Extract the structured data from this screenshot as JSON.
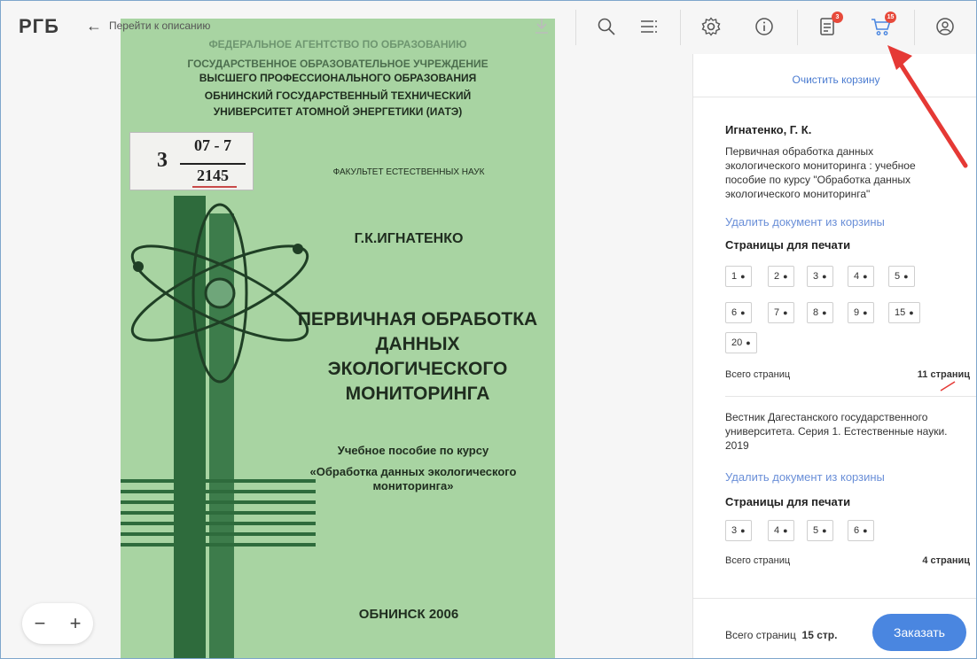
{
  "header": {
    "logo": "РГБ",
    "back_label": "Перейти к описанию",
    "icons": [
      "download-icon",
      "search-icon",
      "contents-icon",
      "settings-icon",
      "info-icon",
      "orders-icon",
      "cart-icon",
      "profile-icon"
    ],
    "orders_badge": "3",
    "cart_badge": "15",
    "accent": "#e74a3b"
  },
  "book": {
    "line1": "ФЕДЕРАЛЬНОЕ АГЕНТСТВО ПО ОБРАЗОВАНИЮ",
    "line2": "ГОСУДАРСТВЕННОЕ ОБРАЗОВАТЕЛЬНОЕ УЧРЕЖДЕНИЕ",
    "line3": "ВЫСШЕГО ПРОФЕССИОНАЛЬНОГО ОБРАЗОВАНИЯ",
    "line4": "ОБНИНСКИЙ ГОСУДАРСТВЕННЫЙ ТЕХНИЧЕСКИЙ",
    "line5": "УНИВЕРСИТЕТ АТОМНОЙ ЭНЕРГЕТИКИ (ИАТЭ)",
    "stamp_left": "3",
    "stamp_top": "07 - 7",
    "stamp_bottom": "2145",
    "faculty": "ФАКУЛЬТЕТ ЕСТЕСТВЕННЫХ НАУК",
    "author": "Г.К.ИГНАТЕНКО",
    "title1": "ПЕРВИЧНАЯ ОБРАБОТКА",
    "title2": "ДАННЫХ",
    "title3": "ЭКОЛОГИЧЕСКОГО",
    "title4": "МОНИТОРИНГА",
    "sub1": "Учебное пособие по курсу",
    "sub2": "«Обработка данных экологического",
    "sub3": "мониторинга»",
    "city": "ОБНИНСК 2006",
    "color": "#a8d4a2"
  },
  "panel": {
    "clear_cart": "Очистить корзину",
    "doc1": {
      "author": "Игнатенко, Г. К.",
      "title_line1": "Первичная обработка данных",
      "title_line2": "экологического мониторинга : учебное",
      "title_line3": "пособие по курсу \"Обработка данных",
      "title_line4": "экологического мониторинга\"",
      "remove": "Удалить документ из корзины",
      "pages_header": "Страницы для печати",
      "pages": [
        "1",
        "2",
        "3",
        "4",
        "5",
        "6",
        "7",
        "8",
        "9",
        "15",
        "20"
      ],
      "total_label": "Всего страниц",
      "total_value": "11 страниц"
    },
    "doc2": {
      "title_line1": "Вестник Дагестанского государственного",
      "title_line2": "университета. Серия 1. Естественные науки.",
      "title_line3": "2019",
      "remove": "Удалить документ из корзины",
      "pages_header": "Страницы для печати",
      "pages": [
        "3",
        "4",
        "5",
        "6"
      ],
      "total_label": "Всего страниц",
      "total_value": "4 страниц"
    },
    "footer_label": "Всего страниц",
    "footer_value": "15 стр.",
    "order_button": "Заказать",
    "order_color": "#4a86e0"
  },
  "zoom": {
    "minus": "−",
    "plus": "+"
  }
}
